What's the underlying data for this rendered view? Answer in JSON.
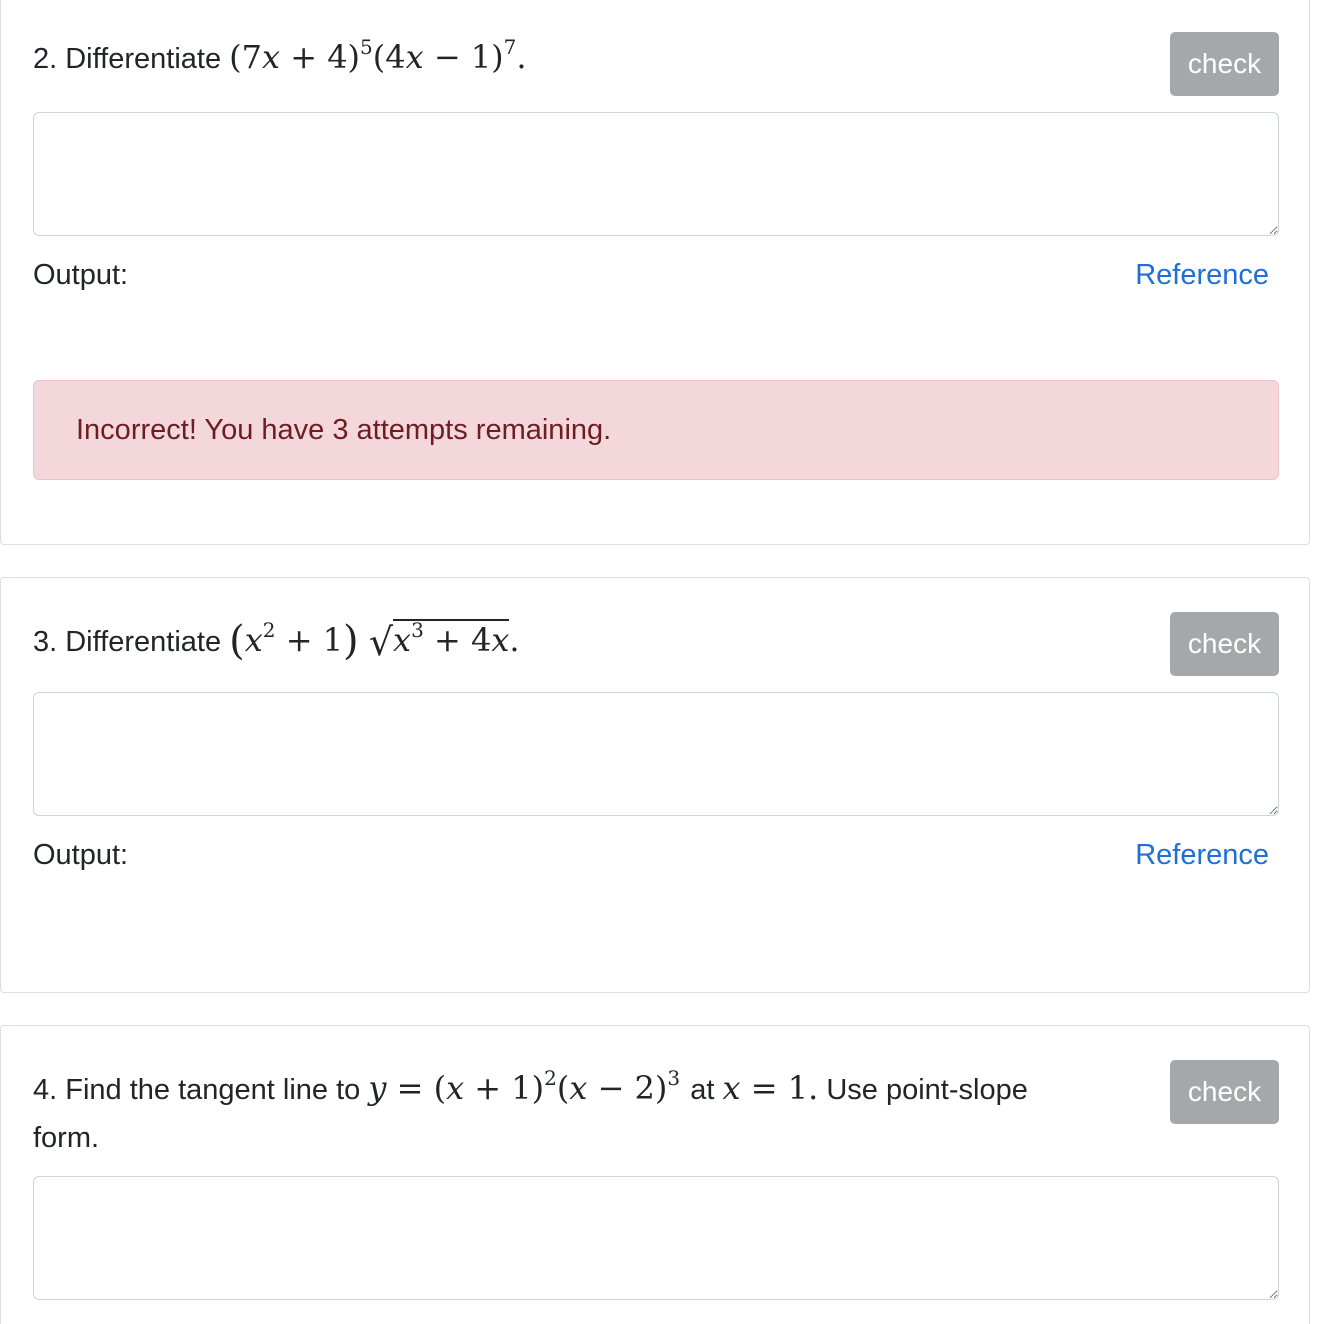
{
  "questions": [
    {
      "number_prefix": "2. Differentiate",
      "math": {
        "open1": "(7",
        "var1": "x",
        "mid1": " + 4)",
        "exp1": "5",
        "open2": "(4",
        "var2": "x",
        "mid2": " − 1)",
        "exp2": "7",
        "end": "."
      },
      "check_label": "check",
      "answer_value": "",
      "output_label": "Output:",
      "reference_label": "Reference",
      "alert_text": "Incorrect! You have 3 attempts remaining."
    },
    {
      "number_prefix": "3. Differentiate",
      "math": {
        "lparen": "(",
        "var1": "x",
        "exp1": "2",
        "mid1": " + 1",
        "rparen": ")",
        "sqrt_sign": "√",
        "var2": "x",
        "exp2": "3",
        "mid2": " + 4",
        "var3": "x",
        "end": "."
      },
      "check_label": "check",
      "answer_value": "",
      "output_label": "Output:",
      "reference_label": "Reference"
    },
    {
      "number_prefix": "4. Find the tangent line to",
      "math": {
        "yvar": "y",
        "eq": " = (",
        "var1": "x",
        "mid1": " + 1)",
        "exp1": "2",
        "open2": "(",
        "var2": "x",
        "mid2": " − 2)",
        "exp2": "3",
        "at_text": "at",
        "xvar": "x",
        "eq2": " = 1.",
        "tail": "Use point-slope",
        "line2": "form."
      },
      "check_label": "check",
      "answer_value": ""
    }
  ],
  "colors": {
    "check_button": "#a5a8ab",
    "reference_link": "#1f6fd6",
    "alert_bg": "#f4d7da",
    "alert_text": "#6e1d24"
  }
}
